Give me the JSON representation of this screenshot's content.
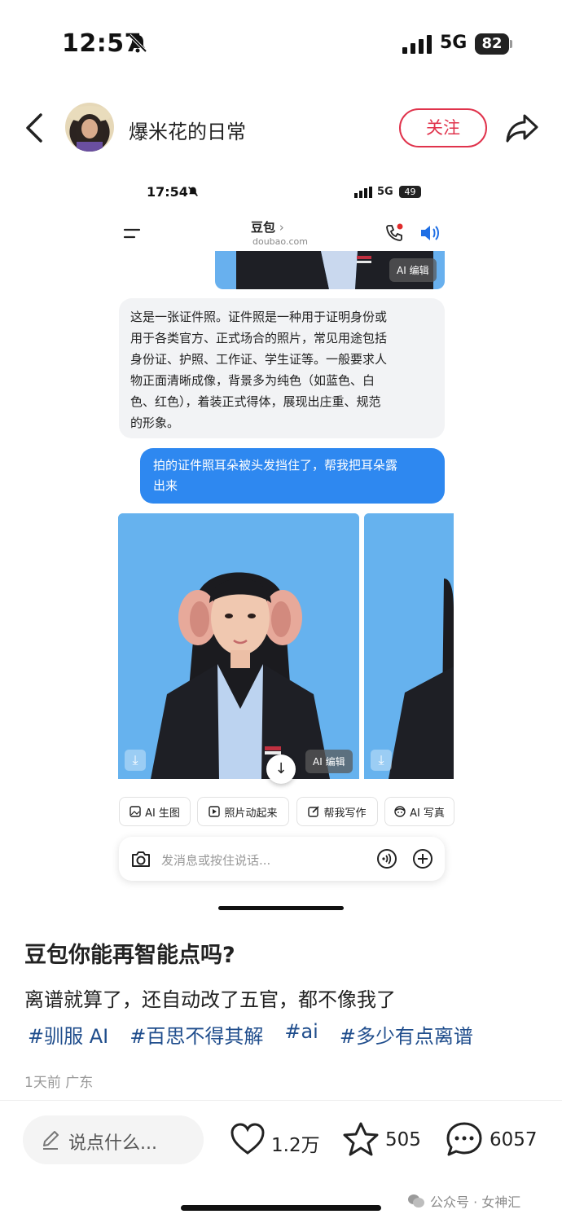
{
  "status_bar": {
    "time": "12:57",
    "network": "5G",
    "battery": "82"
  },
  "header": {
    "author_name": "爆米花的日常",
    "follow_label": "关注"
  },
  "embedded_screen": {
    "status": {
      "time": "17:54",
      "network": "5G",
      "battery": "49"
    },
    "app_title": "豆包",
    "app_url": "doubao.com",
    "ai_edit_label": "AI 编辑",
    "ai_message_lines": [
      "这是一张证件照。证件照是一种用于证明身份或",
      "用于各类官方、正式场合的照片，常见用途包括",
      "身份证、护照、工作证、学生证等。一般要求人",
      "物正面清晰成像，背景多为纯色（如蓝色、白",
      "色、红色），着装正式得体，展现出庄重、规范",
      "的形象。"
    ],
    "user_message_lines": [
      "拍的证件照耳朵被头发挡住了，帮我把耳朵露",
      "出来"
    ],
    "chips": [
      {
        "label": "AI 生图",
        "icon": "image-icon"
      },
      {
        "label": "照片动起来",
        "icon": "play-icon"
      },
      {
        "label": "帮我写作",
        "icon": "edit-icon"
      },
      {
        "label": "AI 写真",
        "icon": "face-icon"
      }
    ],
    "input_placeholder": "发消息或按住说话..."
  },
  "post": {
    "title": "豆包你能再智能点吗?",
    "body": "离谱就算了，还自动改了五官，都不像我了",
    "tags": [
      "#驯服 AI",
      "#百思不得其解",
      "#ai",
      "#多少有点离谱"
    ],
    "meta": "1天前 广东"
  },
  "bottom_bar": {
    "comment_placeholder": "说点什么...",
    "likes": "1.2万",
    "favorites": "505",
    "comments": "6057"
  },
  "watermark": "公众号 · 女神汇",
  "colors": {
    "follow_red": "#e0334c",
    "tag_blue": "#1f4d8c",
    "user_bubble": "#2e88f0",
    "photo_bg": "#66b2ee"
  }
}
